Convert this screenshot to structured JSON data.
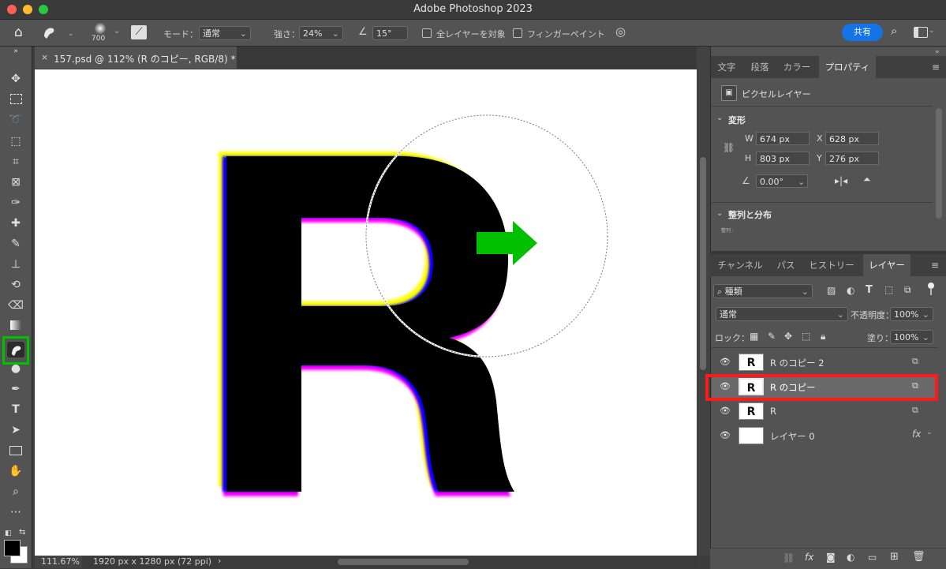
{
  "app": {
    "title": "Adobe Photoshop 2023"
  },
  "options": {
    "brush_size": "700",
    "mode_label": "モード：",
    "mode_value": "通常",
    "strength_label": "強さ：",
    "strength_value": "24%",
    "angle_value": "15°",
    "all_layers_label": "全レイヤーを対象",
    "finger_paint_label": "フィンガーペイント",
    "share_label": "共有"
  },
  "document": {
    "tab_title": "157.psd @ 112% (R のコピー, RGB/8) *",
    "zoom": "111.67%",
    "dimensions": "1920 px x 1280 px (72 ppi)"
  },
  "properties": {
    "tabs": [
      "文字",
      "段落",
      "カラー",
      "プロパティ"
    ],
    "active_tab": "プロパティ",
    "layer_kind": "ピクセルレイヤー",
    "transform_header": "変形",
    "w_label": "W",
    "w_value": "674 px",
    "h_label": "H",
    "h_value": "803 px",
    "x_label": "X",
    "x_value": "628 px",
    "y_label": "Y",
    "y_value": "276 px",
    "rotation_value": "0.00°",
    "align_header": "整列と分布",
    "align_sub": "整列 :"
  },
  "layers_panel": {
    "tabs": [
      "チャンネル",
      "パス",
      "ヒストリー",
      "レイヤー"
    ],
    "active_tab": "レイヤー",
    "filter_kind": "種類",
    "blend_mode": "通常",
    "opacity_label": "不透明度：",
    "opacity_value": "100%",
    "lock_label": "ロック：",
    "fill_label": "塗り：",
    "fill_value": "100%",
    "layers": [
      {
        "name": "R のコピー 2",
        "thumb": "R",
        "selected": false
      },
      {
        "name": "R のコピー",
        "thumb": "R",
        "selected": true
      },
      {
        "name": "R",
        "thumb": "R",
        "selected": false
      },
      {
        "name": "レイヤー 0",
        "thumb": "",
        "selected": false,
        "fx": "fx"
      }
    ]
  },
  "colors": {
    "highlight_red": "#ff1a1a",
    "highlight_green": "#00c000",
    "accent_blue": "#1473e6"
  }
}
